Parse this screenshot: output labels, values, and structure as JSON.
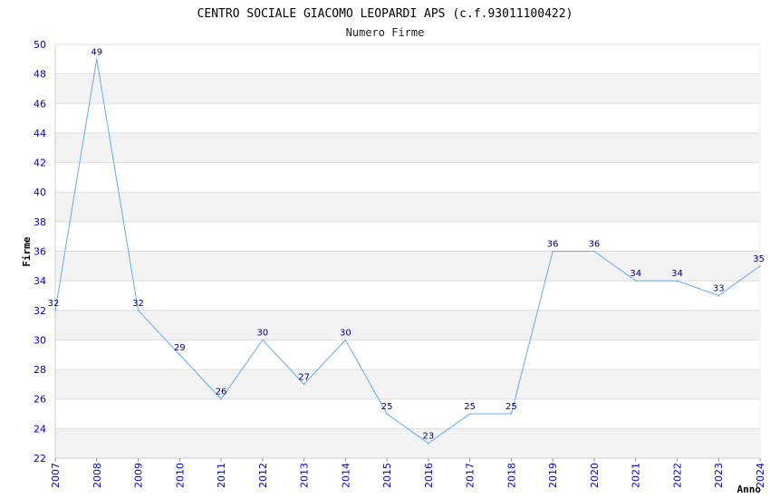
{
  "chart_data": {
    "type": "line",
    "title": "CENTRO SOCIALE GIACOMO LEOPARDI APS (c.f.93011100422)",
    "subtitle": "Numero Firme",
    "xlabel": "Anno",
    "ylabel": "Firme",
    "ylim": [
      22,
      50
    ],
    "ytick_step": 2,
    "grid": "horizontal alternating bands",
    "x": [
      "2007",
      "2008",
      "2009",
      "2010",
      "2011",
      "2012",
      "2013",
      "2014",
      "2015",
      "2016",
      "2017",
      "2018",
      "2019",
      "2020",
      "2021",
      "2022",
      "2023",
      "2024"
    ],
    "series": [
      {
        "values": [
          32,
          49,
          32,
          29,
          26,
          30,
          27,
          30,
          25,
          23,
          25,
          25,
          36,
          36,
          34,
          34,
          33,
          35
        ]
      }
    ],
    "colors": {
      "line": "#66aaee",
      "tick": "#0000cc",
      "data_label": "#000080",
      "band": "#f2f2f2",
      "grid": "#dddddd"
    }
  }
}
